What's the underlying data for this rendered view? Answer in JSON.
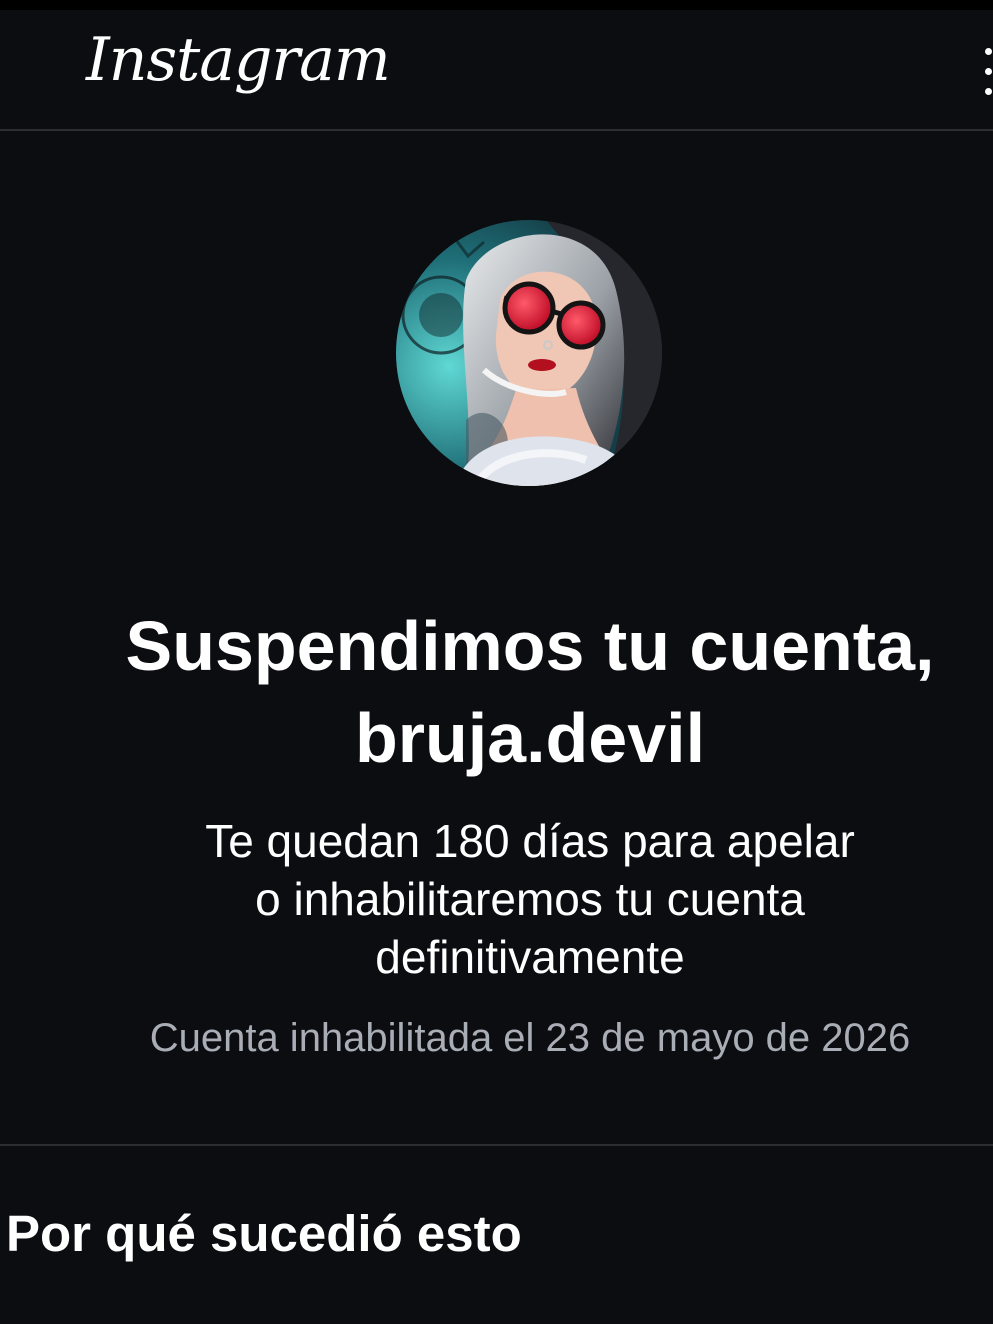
{
  "header": {
    "logo_text": "Instagram",
    "menu_icon": "vertical-ellipsis-icon"
  },
  "profile": {
    "avatar_icon": "profile-photo-avatar"
  },
  "suspension": {
    "headline_line1": "Suspendimos tu cuenta,",
    "headline_line2": "bruja.devil",
    "appeal_line1": "Te quedan 180 días para apelar",
    "appeal_line2": "o inhabilitaremos tu cuenta",
    "appeal_line3": "definitivamente",
    "disabled_date": "Cuenta inhabilitada el 23 de mayo de 2026"
  },
  "section": {
    "why_title": "Por qué sucedió esto"
  },
  "colors": {
    "background": "#0b0d11",
    "text_primary": "#ffffff",
    "text_secondary": "#a9adb5",
    "divider": "#2a2d32"
  }
}
